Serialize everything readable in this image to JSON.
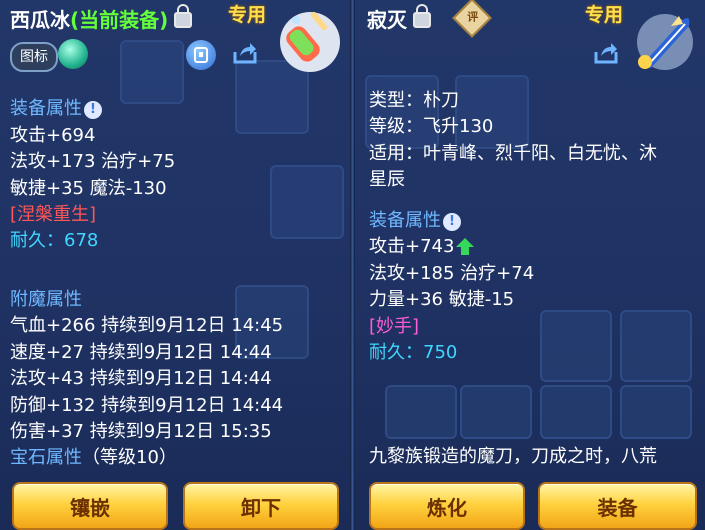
{
  "left": {
    "title": "西瓜冰",
    "title_sub": "(当前装备)",
    "exclusive_tag": "专用",
    "icon_badge": "图标",
    "stats_header": "装备属性",
    "stats": [
      "攻击+694",
      "法攻+173 治疗+75",
      "敏捷+35 魔法-130"
    ],
    "special": "[涅槃重生]",
    "durability": "耐久：678",
    "enchant_header": "附魔属性",
    "enchants": [
      "气血+266 持续到9月12日 14:45",
      "速度+27 持续到9月12日 14:44",
      "法攻+43 持续到9月12日 14:44",
      "防御+132 持续到9月12日 14:44",
      "伤害+37 持续到9月12日 15:35"
    ],
    "gem_header": "宝石属性",
    "gem_level": "（等级10）",
    "buttons": {
      "inlay": "镶嵌",
      "unequip": "卸下"
    },
    "icons": [
      "lock-icon",
      "info-icon",
      "doc-icon",
      "share-icon",
      "popsicle-weapon-icon",
      "orb-icon"
    ]
  },
  "right": {
    "title": "寂灭",
    "exclusive_tag": "专用",
    "review_badge": "评",
    "info_lines": [
      "类型：朴刀",
      "等级：飞升130",
      "适用：叶青峰、烈千阳、白无忧、沐",
      "星辰"
    ],
    "stats_header": "装备属性",
    "stats": [
      "攻击+743",
      "法攻+185 治疗+74",
      "力量+36 敏捷-15"
    ],
    "special": "[妙手]",
    "durability": "耐久：750",
    "description": "九黎族锻造的魔刀，刀成之时，八荒",
    "buttons": {
      "refine": "炼化",
      "equip": "装备"
    },
    "icons": [
      "lock-icon",
      "info-icon",
      "up-arrow-icon",
      "share-icon",
      "blade-weapon-icon",
      "review-badge-icon"
    ]
  },
  "colors": {
    "title": "#ffffff",
    "current_tag": "#64ff3a",
    "section": "#6fb8ff",
    "nirvana": "#ff5757",
    "durability": "#3fd7ff",
    "skill": "#ff5cd8",
    "button": "#ffd23f"
  }
}
